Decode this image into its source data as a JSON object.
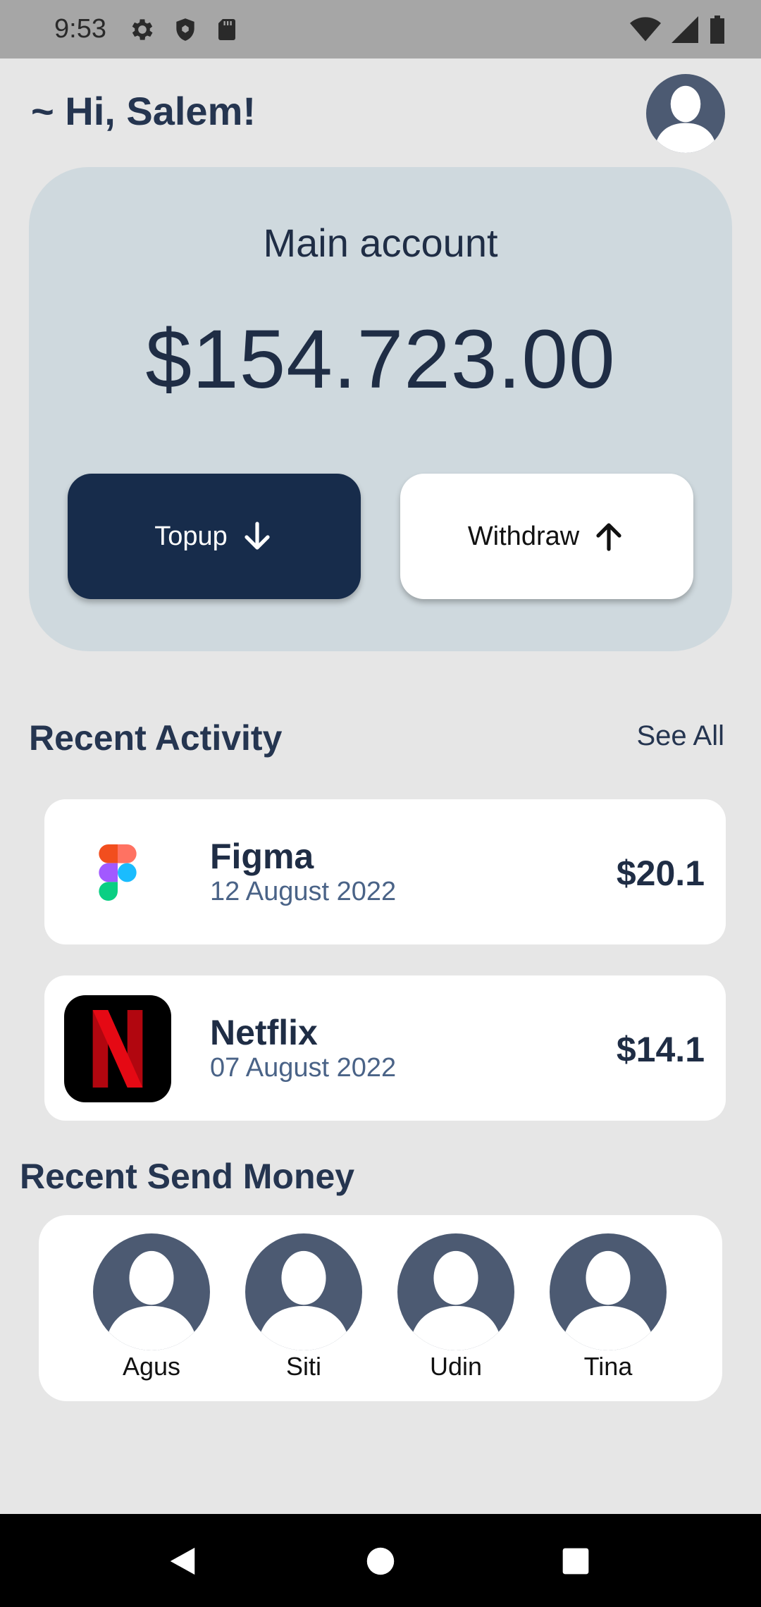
{
  "status_bar": {
    "time": "9:53"
  },
  "header": {
    "greeting": "~ Hi, Salem!"
  },
  "account": {
    "title": "Main account",
    "balance": "$154.723.00",
    "topup_label": "Topup",
    "withdraw_label": "Withdraw"
  },
  "recent_activity": {
    "title": "Recent Activity",
    "see_all": "See All",
    "items": [
      {
        "name": "Figma",
        "date": "12 August 2022",
        "amount": "$20.1",
        "icon": "figma-logo-icon"
      },
      {
        "name": "Netflix",
        "date": "07 August 2022",
        "amount": "$14.1",
        "icon": "netflix-logo-icon"
      }
    ]
  },
  "recent_send": {
    "title": "Recent Send Money",
    "contacts": [
      {
        "name": "Agus"
      },
      {
        "name": "Siti"
      },
      {
        "name": "Udin"
      },
      {
        "name": "Tina"
      }
    ]
  },
  "colors": {
    "primary": "#172c4b",
    "card_bg": "#cfd9de",
    "page_bg": "#e6e6e6",
    "text": "#1f2d45",
    "avatar": "#4c5a72"
  }
}
